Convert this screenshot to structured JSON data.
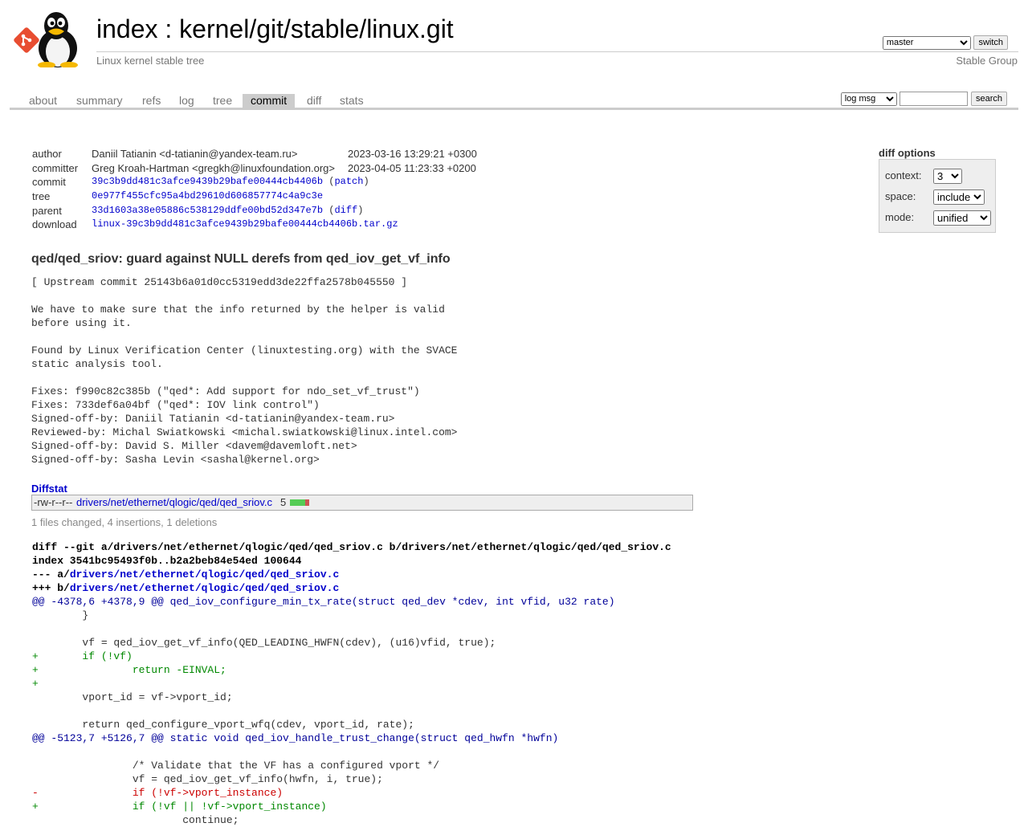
{
  "header": {
    "repo_prefix": "index : ",
    "repo_name": "kernel/git/stable/linux.git",
    "description": "Linux kernel stable tree",
    "owner": "Stable Group",
    "branch": "master",
    "switch_label": "switch"
  },
  "tabs": [
    "about",
    "summary",
    "refs",
    "log",
    "tree",
    "commit",
    "diff",
    "stats"
  ],
  "active_tab": "commit",
  "search": {
    "scope": "log msg",
    "value": "",
    "button": "search"
  },
  "commit_info": {
    "author_label": "author",
    "author": "Daniil Tatianin <d-tatianin@yandex-team.ru>",
    "author_date": "2023-03-16 13:29:21 +0300",
    "committer_label": "committer",
    "committer": "Greg Kroah-Hartman <gregkh@linuxfoundation.org>",
    "committer_date": "2023-04-05 11:23:33 +0200",
    "commit_label": "commit",
    "commit": "39c3b9dd481c3afce9439b29bafe00444cb4406b",
    "patch_label": "patch",
    "tree_label": "tree",
    "tree": "0e977f455cfc95a4bd29610d606857774c4a9c3e",
    "parent_label": "parent",
    "parent": "33d1603a38e05886c538129ddfe00bd52d347e7b",
    "diff_label": "diff",
    "download_label": "download",
    "download": "linux-39c3b9dd481c3afce9439b29bafe00444cb4406b.tar.gz"
  },
  "diff_options": {
    "title": "diff options",
    "context_label": "context:",
    "context": "3",
    "space_label": "space:",
    "space": "include",
    "mode_label": "mode:",
    "mode": "unified"
  },
  "subject": "qed/qed_sriov: guard against NULL derefs from qed_iov_get_vf_info",
  "message": "[ Upstream commit 25143b6a01d0cc5319edd3de22ffa2578b045550 ]\n\nWe have to make sure that the info returned by the helper is valid\nbefore using it.\n\nFound by Linux Verification Center (linuxtesting.org) with the SVACE\nstatic analysis tool.\n\nFixes: f990c82c385b (\"qed*: Add support for ndo_set_vf_trust\")\nFixes: 733def6a04bf (\"qed*: IOV link control\")\nSigned-off-by: Daniil Tatianin <d-tatianin@yandex-team.ru>\nReviewed-by: Michal Swiatkowski <michal.swiatkowski@linux.intel.com>\nSigned-off-by: David S. Miller <davem@davemloft.net>\nSigned-off-by: Sasha Levin <sashal@kernel.org>",
  "diffstat": {
    "header": "Diffstat",
    "mode": "-rw-r--r--",
    "file": "drivers/net/ethernet/qlogic/qed/qed_sriov.c",
    "count": "5",
    "insertions": 4,
    "deletions": 1,
    "summary": "1 files changed, 4 insertions, 1 deletions"
  },
  "diff": {
    "git_line": "diff --git a/drivers/net/ethernet/qlogic/qed/qed_sriov.c b/drivers/net/ethernet/qlogic/qed/qed_sriov.c",
    "index_line": "index 3541bc95493f0b..b2a2beb84e54ed 100644",
    "minus_prefix": "--- a/",
    "plus_prefix": "+++ b/",
    "file_path": "drivers/net/ethernet/qlogic/qed/qed_sriov.c",
    "lines": [
      {
        "type": "hunk",
        "text": "@@ -4378,6 +4378,9 @@ qed_iov_configure_min_tx_rate(struct qed_dev *cdev, int vfid, u32 rate)"
      },
      {
        "type": "ctx",
        "text": " \t}"
      },
      {
        "type": "ctx",
        "text": " "
      },
      {
        "type": "ctx",
        "text": " \tvf = qed_iov_get_vf_info(QED_LEADING_HWFN(cdev), (u16)vfid, true);"
      },
      {
        "type": "add",
        "text": "+\tif (!vf)"
      },
      {
        "type": "add",
        "text": "+\t\treturn -EINVAL;"
      },
      {
        "type": "add",
        "text": "+"
      },
      {
        "type": "ctx",
        "text": " \tvport_id = vf->vport_id;"
      },
      {
        "type": "ctx",
        "text": " "
      },
      {
        "type": "ctx",
        "text": " \treturn qed_configure_vport_wfq(cdev, vport_id, rate);"
      },
      {
        "type": "hunk",
        "text": "@@ -5123,7 +5126,7 @@ static void qed_iov_handle_trust_change(struct qed_hwfn *hwfn)"
      },
      {
        "type": "ctx",
        "text": " "
      },
      {
        "type": "ctx",
        "text": " \t\t/* Validate that the VF has a configured vport */"
      },
      {
        "type": "ctx",
        "text": " \t\tvf = qed_iov_get_vf_info(hwfn, i, true);"
      },
      {
        "type": "del",
        "text": "-\t\tif (!vf->vport_instance)"
      },
      {
        "type": "add",
        "text": "+\t\tif (!vf || !vf->vport_instance)"
      },
      {
        "type": "ctx",
        "text": " \t\t\tcontinue;"
      }
    ]
  }
}
